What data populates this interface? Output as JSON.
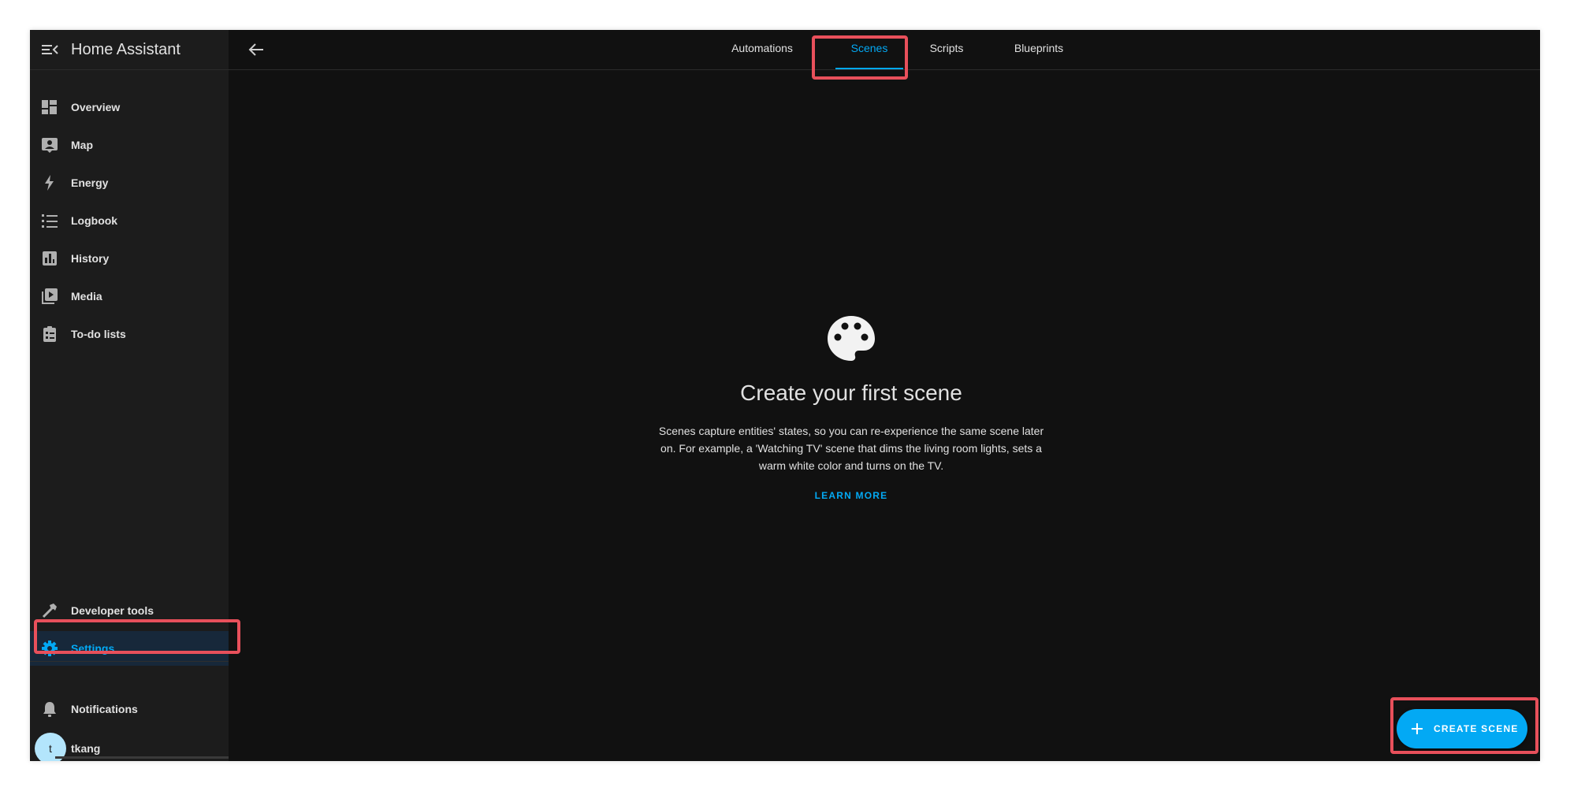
{
  "app": {
    "title": "Home Assistant"
  },
  "sidebar": {
    "items": [
      {
        "label": "Overview",
        "icon": "dashboard-icon"
      },
      {
        "label": "Map",
        "icon": "map-icon"
      },
      {
        "label": "Energy",
        "icon": "lightning-bolt-icon"
      },
      {
        "label": "Logbook",
        "icon": "list-icon"
      },
      {
        "label": "History",
        "icon": "chart-box-icon"
      },
      {
        "label": "Media",
        "icon": "play-box-icon"
      },
      {
        "label": "To-do lists",
        "icon": "clipboard-list-icon"
      }
    ],
    "developer_tools": "Developer tools",
    "settings": "Settings",
    "notifications": "Notifications",
    "user": {
      "name": "tkang",
      "initial": "t"
    }
  },
  "tabs": [
    {
      "label": "Automations",
      "active": false
    },
    {
      "label": "Scenes",
      "active": true
    },
    {
      "label": "Scripts",
      "active": false
    },
    {
      "label": "Blueprints",
      "active": false
    }
  ],
  "empty_state": {
    "icon": "palette-icon",
    "title": "Create your first scene",
    "description": "Scenes capture entities' states, so you can re-experience the same scene later on. For example, a 'Watching TV' scene that dims the living room lights, sets a warm white color and turns on the TV.",
    "learn_more": "LEARN MORE"
  },
  "fab": {
    "label": "CREATE SCENE",
    "icon": "plus-icon"
  },
  "colors": {
    "accent": "#03a9f4",
    "background": "#111111",
    "sidebar": "#1c1c1c",
    "highlight": "#e8505b"
  }
}
